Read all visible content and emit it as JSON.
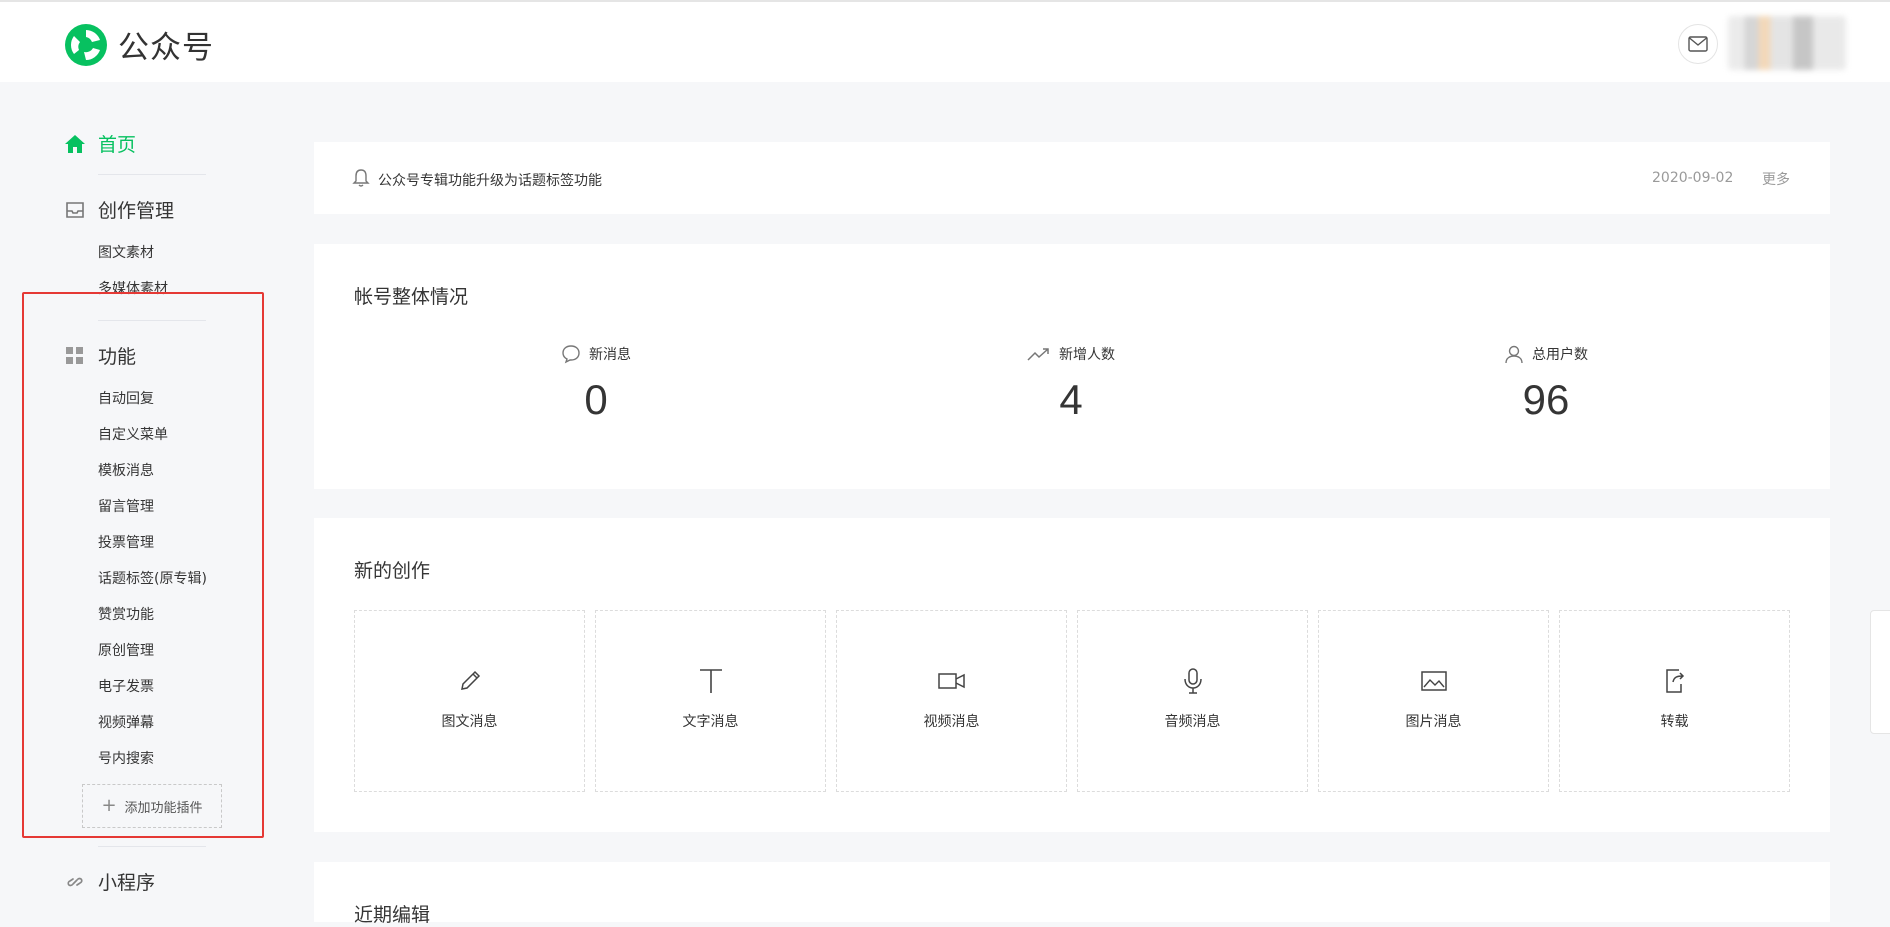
{
  "header": {
    "brand_name": "公众号",
    "brand_color": "#07c160"
  },
  "sidebar": {
    "home": {
      "label": "首页",
      "icon": "home-icon"
    },
    "creation": {
      "label": "创作管理",
      "icon": "inbox-icon",
      "items": [
        "图文素材",
        "多媒体素材"
      ]
    },
    "functions": {
      "label": "功能",
      "icon": "grid-icon",
      "items": [
        "自动回复",
        "自定义菜单",
        "模板消息",
        "留言管理",
        "投票管理",
        "话题标签(原专辑)",
        "赞赏功能",
        "原创管理",
        "电子发票",
        "视频弹幕",
        "号内搜索"
      ],
      "add_plugin": "添加功能插件"
    },
    "miniprogram": {
      "label": "小程序",
      "icon": "link-icon"
    }
  },
  "notice": {
    "text": "公众号专辑功能升级为话题标签功能",
    "date": "2020-09-02",
    "more": "更多"
  },
  "overview": {
    "title": "帐号整体情况",
    "stats": [
      {
        "label": "新消息",
        "value": "0",
        "icon": "chat-bubble-icon"
      },
      {
        "label": "新增人数",
        "value": "4",
        "icon": "trend-up-icon"
      },
      {
        "label": "总用户数",
        "value": "96",
        "icon": "user-icon"
      }
    ]
  },
  "create": {
    "title": "新的创作",
    "tiles": [
      {
        "label": "图文消息",
        "icon": "pencil-icon"
      },
      {
        "label": "文字消息",
        "icon": "text-icon"
      },
      {
        "label": "视频消息",
        "icon": "video-icon"
      },
      {
        "label": "音频消息",
        "icon": "microphone-icon"
      },
      {
        "label": "图片消息",
        "icon": "image-icon"
      },
      {
        "label": "转载",
        "icon": "share-icon"
      }
    ]
  },
  "next_section": {
    "title": "近期编辑"
  }
}
